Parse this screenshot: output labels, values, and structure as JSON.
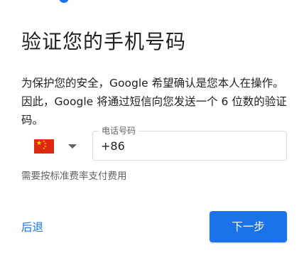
{
  "title": "验证您的手机号码",
  "description": "为保护您的安全，Google 希望确认是您本人在操作。因此，Google 将通过短信向您发送一个 6 位数的验证码。",
  "country_picker": {
    "selected_country_flag": "china-flag-icon"
  },
  "phone_field": {
    "label": "电话号码",
    "value": "+86"
  },
  "fee_note": "需要按标准费率支付费用",
  "actions": {
    "back_label": "后退",
    "next_label": "下一步"
  },
  "colors": {
    "accent": "#1a73e8",
    "text_primary": "#202124",
    "text_secondary": "#5f6368",
    "border": "#dadce0",
    "flag_red": "#de2910",
    "flag_yellow": "#ffde00"
  }
}
